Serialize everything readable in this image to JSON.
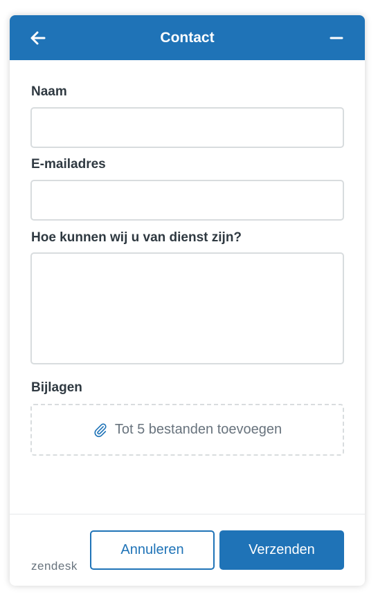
{
  "colors": {
    "primary": "#1f73b7",
    "label_text": "#2f3941",
    "muted_text": "#68737d",
    "border": "#d8dcde"
  },
  "header": {
    "title": "Contact",
    "back_icon": "arrow-left-icon",
    "minimize_icon": "minus-icon"
  },
  "form": {
    "name_label": "Naam",
    "name_value": "",
    "email_label": "E-mailadres",
    "email_value": "",
    "message_label": "Hoe kunnen wij u van dienst zijn?",
    "message_value": "",
    "attachments_label": "Bijlagen",
    "attachments_icon": "paperclip-icon",
    "attachments_hint": "Tot 5 bestanden toevoegen"
  },
  "footer": {
    "logo_text": "zendesk",
    "cancel_label": "Annuleren",
    "submit_label": "Verzenden"
  }
}
